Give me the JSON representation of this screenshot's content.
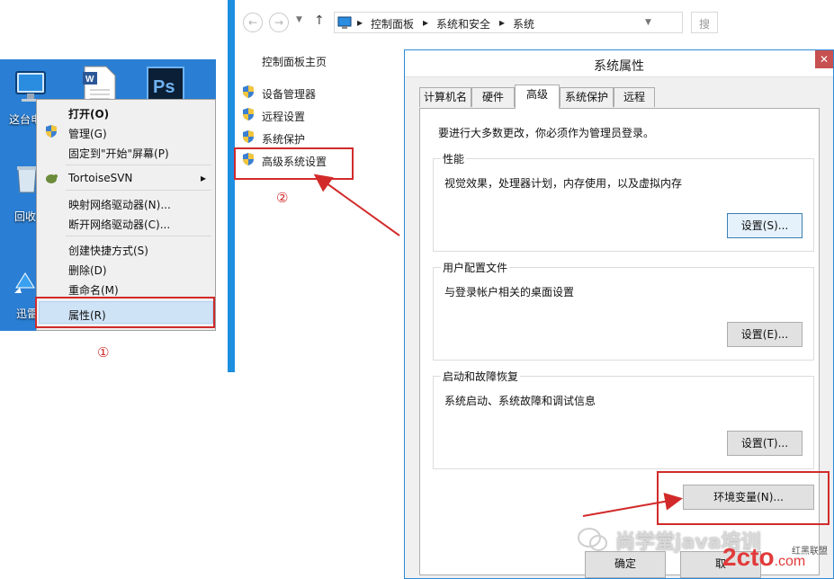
{
  "desktop": {
    "icons": [
      {
        "name": "computer",
        "label": "这台电脑"
      },
      {
        "name": "word-doc",
        "label": ""
      },
      {
        "name": "photoshop",
        "label": ""
      },
      {
        "name": "recycle-bin",
        "label": "回收"
      },
      {
        "name": "xunlei",
        "label": "迅雷"
      }
    ],
    "context_menu": {
      "items": [
        {
          "label": "打开(O)",
          "bold": true
        },
        {
          "label": "管理(G)"
        },
        {
          "label": "固定到\"开始\"屏幕(P)"
        },
        {
          "label": "TortoiseSVN",
          "submenu": "▸"
        },
        {
          "label": "映射网络驱动器(N)..."
        },
        {
          "label": "断开网络驱动器(C)..."
        },
        {
          "label": "创建快捷方式(S)"
        },
        {
          "label": "删除(D)"
        },
        {
          "label": "重命名(M)"
        },
        {
          "label": "属性(R)",
          "highlighted": true
        }
      ]
    },
    "step_label": "①"
  },
  "control_panel": {
    "breadcrumbs": [
      "控制面板",
      "系统和安全",
      "系统"
    ],
    "search_placeholder": "搜",
    "home_link": "控制面板主页",
    "links": [
      "设备管理器",
      "远程设置",
      "系统保护",
      "高级系统设置"
    ],
    "step_label": "②"
  },
  "dialog": {
    "title": "系统属性",
    "close": "✕",
    "tabs": [
      "计算机名",
      "硬件",
      "高级",
      "系统保护",
      "远程"
    ],
    "active_tab": "高级",
    "admin_note": "要进行大多数更改，你必须作为管理员登录。",
    "groups": [
      {
        "title": "性能",
        "desc": "视觉效果，处理器计划，内存使用，以及虚拟内存",
        "button": "设置(S)..."
      },
      {
        "title": "用户配置文件",
        "desc": "与登录帐户相关的桌面设置",
        "button": "设置(E)..."
      },
      {
        "title": "启动和故障恢复",
        "desc": "系统启动、系统故障和调试信息",
        "button": "设置(T)..."
      }
    ],
    "env_button": "环境变量(N)...",
    "ok_button": "确定",
    "cancel_button": "取"
  },
  "watermark": {
    "text": "尚学堂java培训",
    "site": "2cto",
    "site_suffix": ".com",
    "alliance": "红黑联盟"
  },
  "colors": {
    "annotation_red": "#d22a2a",
    "desktop_blue": "#2a7fd4",
    "window_border": "#1d8fe1"
  }
}
